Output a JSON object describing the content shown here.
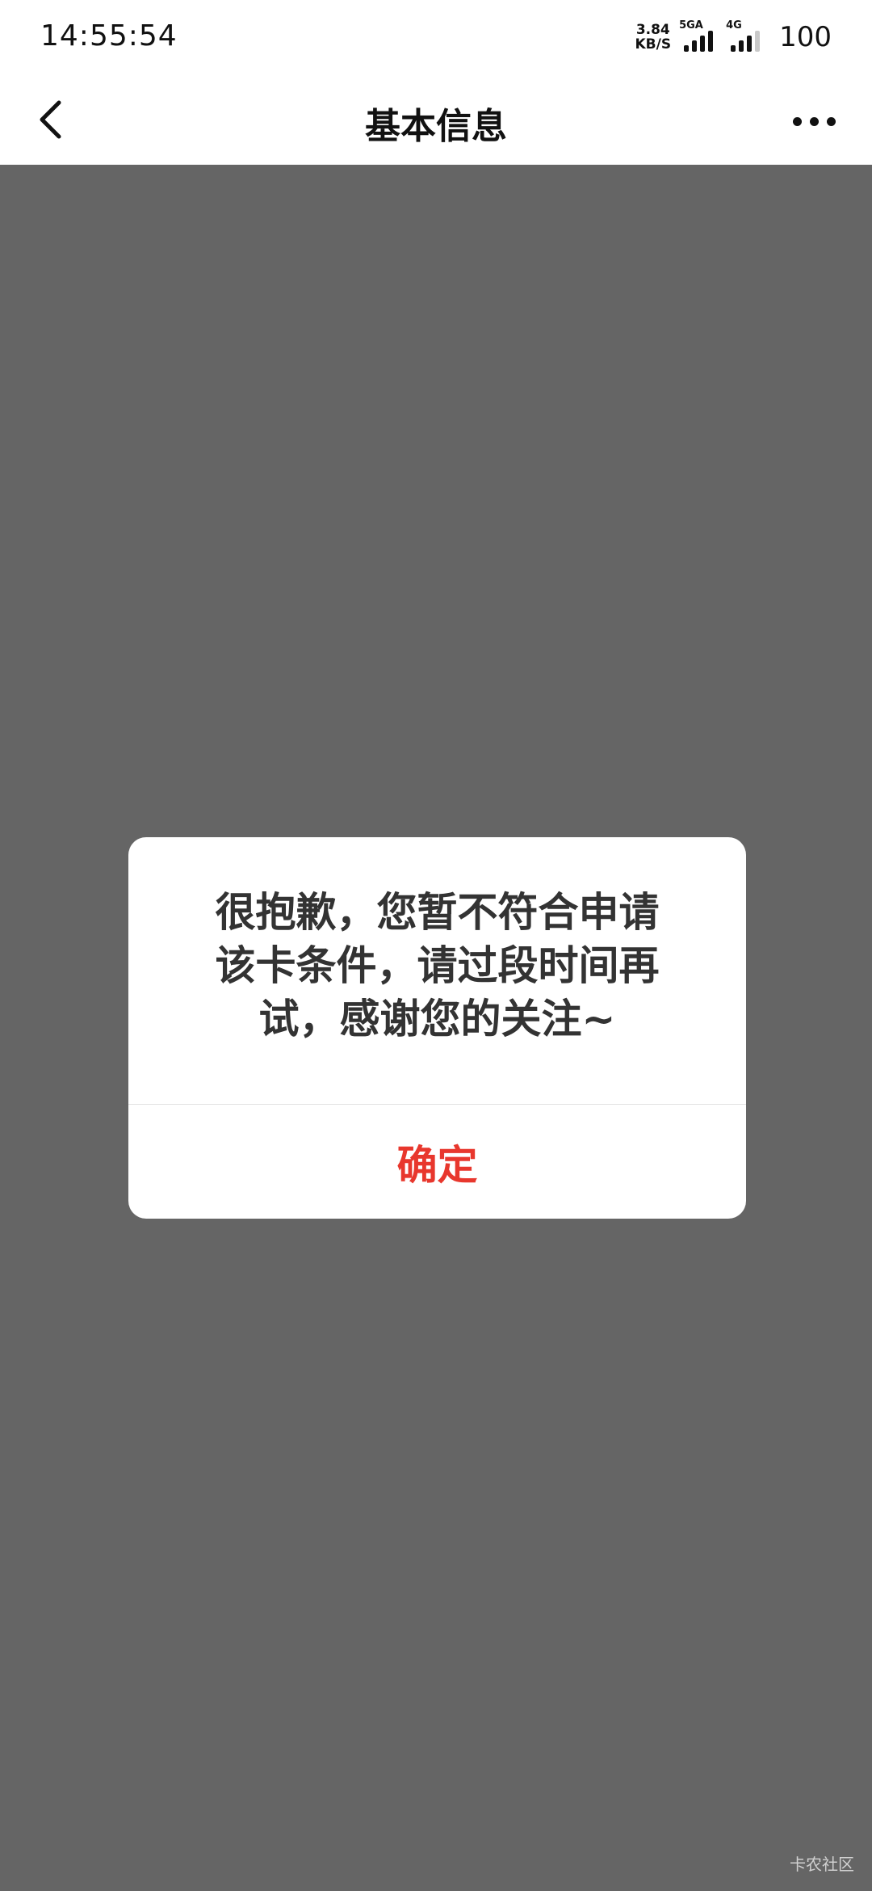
{
  "status_bar": {
    "time": "14:55:54",
    "net_speed_value": "3.84",
    "net_speed_unit": "KB/S",
    "sim1_label": "5GA",
    "sim2_label": "4G",
    "battery": "100"
  },
  "nav": {
    "title": "基本信息",
    "back_icon": "chevron-left-icon",
    "more_icon": "more-horizontal-icon"
  },
  "dialog": {
    "message": "很抱歉，您暂不符合申请该卡条件，请过段时间再试，感谢您的关注~",
    "confirm_label": "确定"
  },
  "watermark": "卡农社区",
  "colors": {
    "overlay": "#656565",
    "confirm_text": "#e8372d",
    "message_text": "#333333"
  }
}
